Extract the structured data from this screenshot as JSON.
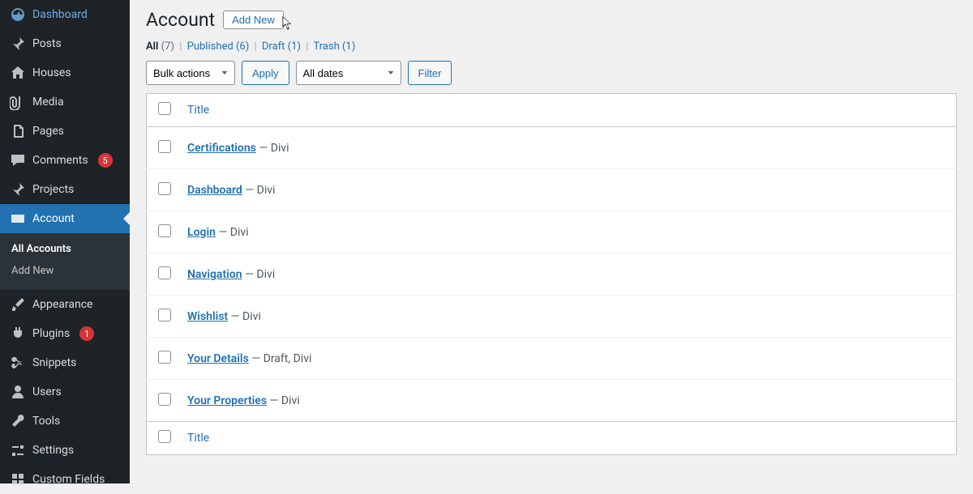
{
  "sidebar": {
    "items": [
      {
        "label": "Dashboard",
        "icon": "dashboard"
      },
      {
        "label": "Posts",
        "icon": "pin"
      },
      {
        "label": "Houses",
        "icon": "home"
      },
      {
        "label": "Media",
        "icon": "media"
      },
      {
        "label": "Pages",
        "icon": "pages"
      },
      {
        "label": "Comments",
        "icon": "comment",
        "badge": "5"
      },
      {
        "label": "Projects",
        "icon": "pin"
      },
      {
        "label": "Account",
        "icon": "card",
        "current": true,
        "submenu": [
          {
            "label": "All Accounts",
            "current": true
          },
          {
            "label": "Add New"
          }
        ]
      },
      {
        "label": "Appearance",
        "icon": "brush"
      },
      {
        "label": "Plugins",
        "icon": "plug",
        "badge": "1"
      },
      {
        "label": "Snippets",
        "icon": "scissors"
      },
      {
        "label": "Users",
        "icon": "user"
      },
      {
        "label": "Tools",
        "icon": "wrench"
      },
      {
        "label": "Settings",
        "icon": "sliders"
      },
      {
        "label": "Custom Fields",
        "icon": "grid"
      }
    ]
  },
  "header": {
    "title": "Account",
    "add_new": "Add New"
  },
  "filters": {
    "all_label": "All",
    "all_count": "(7)",
    "published_label": "Published",
    "published_count": "(6)",
    "draft_label": "Draft",
    "draft_count": "(1)",
    "trash_label": "Trash",
    "trash_count": "(1)"
  },
  "controls": {
    "bulk_actions": "Bulk actions",
    "apply": "Apply",
    "all_dates": "All dates",
    "filter": "Filter"
  },
  "table": {
    "col_title": "Title",
    "rows": [
      {
        "title": "Certifications",
        "state": "— Divi"
      },
      {
        "title": "Dashboard",
        "state": "— Divi"
      },
      {
        "title": "Login",
        "state": "— Divi"
      },
      {
        "title": "Navigation",
        "state": "— Divi"
      },
      {
        "title": "Wishlist",
        "state": "— Divi"
      },
      {
        "title": "Your Details",
        "state": "— Draft, Divi"
      },
      {
        "title": "Your Properties",
        "state": "— Divi"
      }
    ]
  }
}
